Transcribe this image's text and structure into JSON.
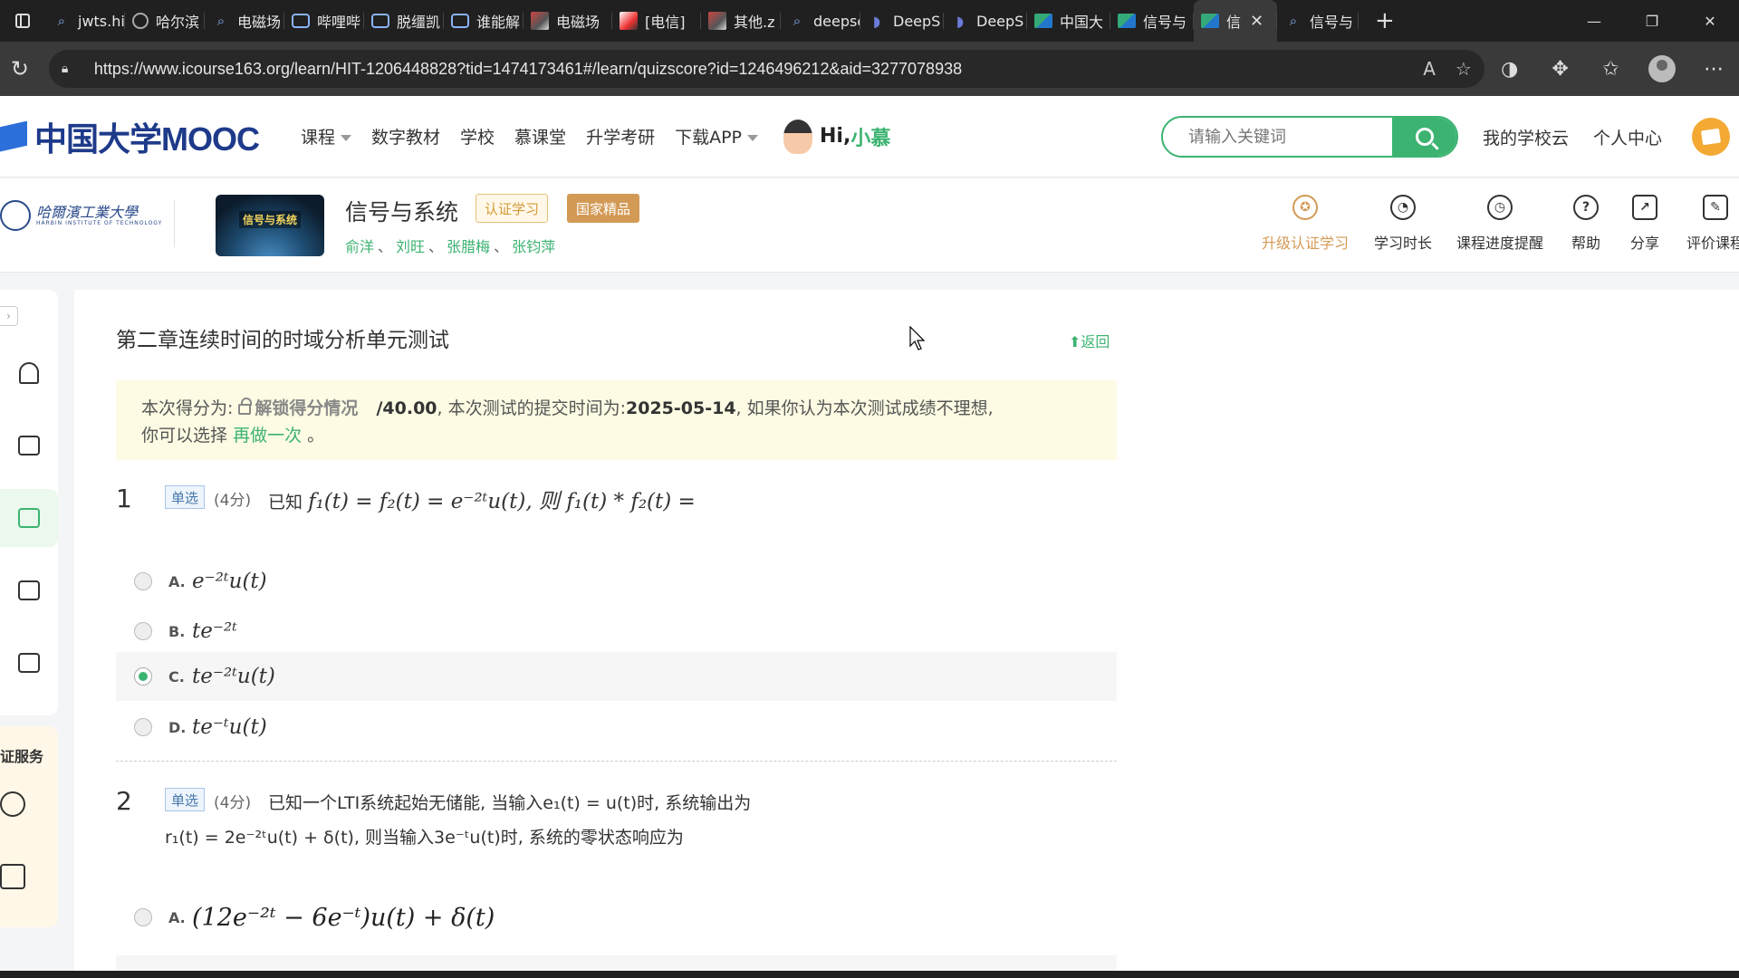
{
  "browser": {
    "tabs": [
      {
        "label": "jwts.hit",
        "icon": "search-icon"
      },
      {
        "label": "哈尔滨",
        "icon": "globe-icon"
      },
      {
        "label": "电磁场",
        "icon": "search-icon"
      },
      {
        "label": "哔哩哔",
        "icon": "tv-icon"
      },
      {
        "label": "脱缰凯",
        "icon": "tv-icon"
      },
      {
        "label": "谁能解",
        "icon": "tv-icon"
      },
      {
        "label": "电磁场",
        "icon": "image-icon"
      },
      {
        "label": "[电信]",
        "icon": "image-icon"
      },
      {
        "label": "其他.z",
        "icon": "image-icon"
      },
      {
        "label": "deepse",
        "icon": "search-icon"
      },
      {
        "label": "DeepS",
        "icon": "whale-icon"
      },
      {
        "label": "DeepS",
        "icon": "whale-icon"
      },
      {
        "label": "中国大",
        "icon": "book-icon"
      },
      {
        "label": "信号与",
        "icon": "book-icon"
      },
      {
        "label": "信",
        "icon": "book-icon",
        "active": true
      },
      {
        "label": "信号与",
        "icon": "search-icon"
      }
    ],
    "new_tab": "+",
    "url": "https://www.icourse163.org/learn/HIT-1206448828?tid=1474173461#/learn/quizscore?id=1246496212&aid=3277078938"
  },
  "site": {
    "logo": "中国大学MOOC",
    "nav": [
      {
        "label": "课程",
        "caret": true
      },
      {
        "label": "数字教材"
      },
      {
        "label": "学校"
      },
      {
        "label": "慕课堂"
      },
      {
        "label": "升学考研"
      },
      {
        "label": "下载APP",
        "caret": true
      }
    ],
    "greeting": "Hi,",
    "user_name": "小慕",
    "search_placeholder": "请输入关键词",
    "my_school_cloud": "我的学校云",
    "personal_center": "个人中心"
  },
  "course": {
    "university": "哈爾濱工業大學",
    "university_en": "HARBIN INSTITUTE OF TECHNOLOGY",
    "thumb_text": "信号与系统",
    "title": "信号与系统",
    "badge_cert": "认证学习",
    "badge_national": "国家精品",
    "teachers": [
      "俞洋",
      "刘旺",
      "张腊梅",
      "张钧萍"
    ],
    "teacher_sep": "、",
    "tools": [
      {
        "label": "升级认证学习",
        "icon": "medal-icon",
        "accent": "#d39a55"
      },
      {
        "label": "学习时长",
        "icon": "clock-icon"
      },
      {
        "label": "课程进度提醒",
        "icon": "alarm-icon"
      },
      {
        "label": "帮助",
        "icon": "help-icon"
      },
      {
        "label": "分享",
        "icon": "share-icon"
      },
      {
        "label": "评价课程",
        "icon": "review-icon"
      }
    ]
  },
  "sidebar": {
    "service_title": "证服务"
  },
  "quiz": {
    "title": "第二章连续时间的时域分析单元测试",
    "back": "返回",
    "notice": {
      "prefix": "本次得分为:",
      "unlock": "解锁得分情况",
      "total": "/40.00",
      "mid": ", 本次测试的提交时间为:",
      "date": "2025-05-14",
      "suffix": ", 如果你认为本次测试成绩不理想,",
      "line2_prefix": "你可以选择",
      "redo": "再做一次",
      "line2_suffix": "。"
    },
    "questions": [
      {
        "num": "1",
        "type": "单选",
        "score": "(4分)",
        "stem_prefix": "已知",
        "stem_math": "f₁(t) = f₂(t) = e⁻²ᵗu(t), 则 f₁(t) * f₂(t) =",
        "options": [
          {
            "letter": "A.",
            "text": "e⁻²ᵗu(t)",
            "selected": false
          },
          {
            "letter": "B.",
            "text": "te⁻²ᵗ",
            "selected": false
          },
          {
            "letter": "C.",
            "text": "te⁻²ᵗu(t)",
            "selected": true
          },
          {
            "letter": "D.",
            "text": "te⁻ᵗu(t)",
            "selected": false
          }
        ]
      },
      {
        "num": "2",
        "type": "单选",
        "score": "(4分)",
        "stem_line1": "已知一个LTI系统起始无储能, 当输入e₁(t) = u(t)时, 系统输出为",
        "stem_line2": "r₁(t) = 2e⁻²ᵗu(t) + δ(t), 则当输入3e⁻ᵗu(t)时, 系统的零状态响应为",
        "options": [
          {
            "letter": "A.",
            "text": "(12e⁻²ᵗ − 6e⁻ᵗ)u(t) + δ(t)",
            "selected": false
          }
        ]
      }
    ]
  },
  "colors": {
    "accent_green": "#3cb371",
    "gold": "#d39a55",
    "notice_bg": "#fdfbe3"
  }
}
